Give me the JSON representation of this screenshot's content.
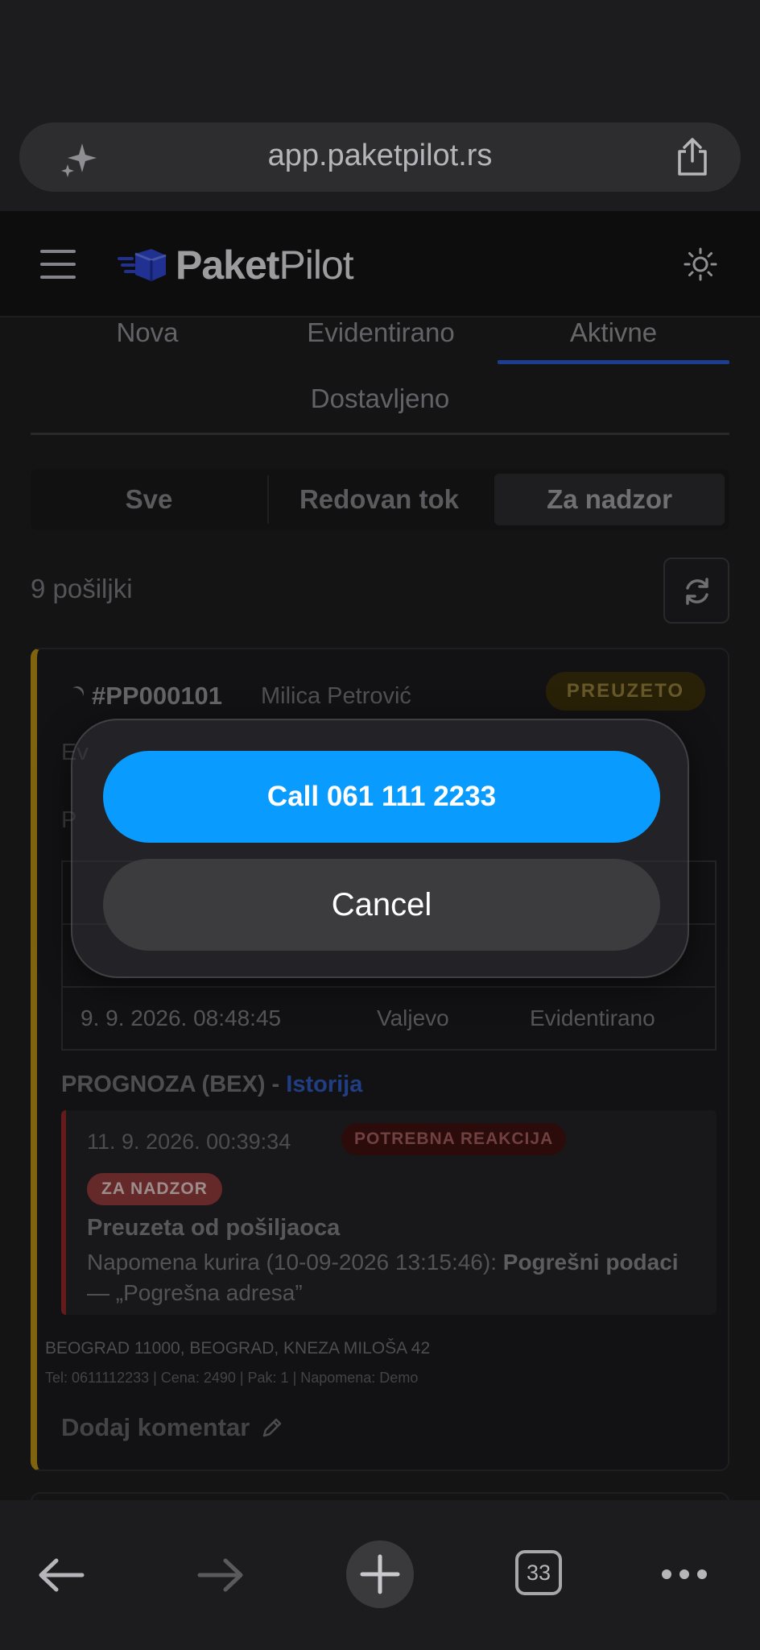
{
  "browser": {
    "url": "app.paketpilot.rs",
    "tabs_count": "33"
  },
  "app": {
    "logo_text_a": "Paket",
    "logo_text_b": "Pilot"
  },
  "status_tabs": [
    "Nova",
    "Evidentirano",
    "Aktivne",
    "Dostavljeno"
  ],
  "active_status_tab": "Aktivne",
  "segments": [
    "Sve",
    "Redovan tok",
    "Za nadzor"
  ],
  "active_segment": "Za nadzor",
  "shipment_count": "9 pošiljki",
  "shipment": {
    "number": "#PP000101",
    "customer": "Milica Petrović",
    "status_badge": "PREUZETO",
    "history_row": {
      "datetime": "9. 9. 2026. 08:48:45",
      "city": "Valjevo",
      "status": "Evidentirano"
    },
    "prognoza_label": "PROGNOZA (BEX) -",
    "prognoza_link": "Istorija",
    "alert": {
      "timestamp": "11. 9. 2026. 00:39:34",
      "reaction_badge": "POTREBNA REAKCIJA",
      "nadzor_badge": "ZA NADZOR",
      "title": "Preuzeta od pošiljaoca",
      "note_prefix": "Napomena kurira (10-09-2026 13:15:46):",
      "note_bold": "Pogrešni podaci",
      "note_suffix": "— „Pogrešna adresa”"
    },
    "address": "BEOGRAD 11000, BEOGRAD, KNEZA MILOŠA 42",
    "meta": "Tel: 0611112233 | Cena: 2490 | Pak: 1 | Napomena: Demo",
    "add_comment": "Dodaj komentar"
  },
  "action_sheet": {
    "call_label": "Call 061 111 2233",
    "cancel_label": "Cancel"
  },
  "colors": {
    "accent_blue": "#0a9bff",
    "tab_underline": "#2957c8",
    "card_border_yellow": "#b08a16",
    "alert_red": "#8d2626"
  }
}
